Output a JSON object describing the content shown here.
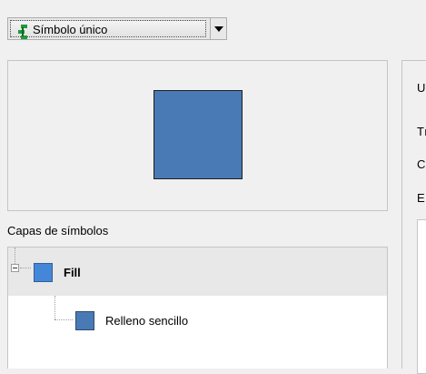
{
  "renderer": {
    "selected": "Símbolo único",
    "icon": "single-symbol-icon"
  },
  "preview": {
    "fill_color": "#4a7ab5",
    "border_color": "#1e1e1e"
  },
  "layers": {
    "title": "Capas de símbolos",
    "items": [
      {
        "label": "Fill",
        "color": "#4487d8",
        "expanded": true
      },
      {
        "label": "Relleno sencillo",
        "color": "#4a7ab5"
      }
    ]
  },
  "right_panel": {
    "labels": [
      "U",
      "Tı",
      "C",
      "E"
    ]
  }
}
